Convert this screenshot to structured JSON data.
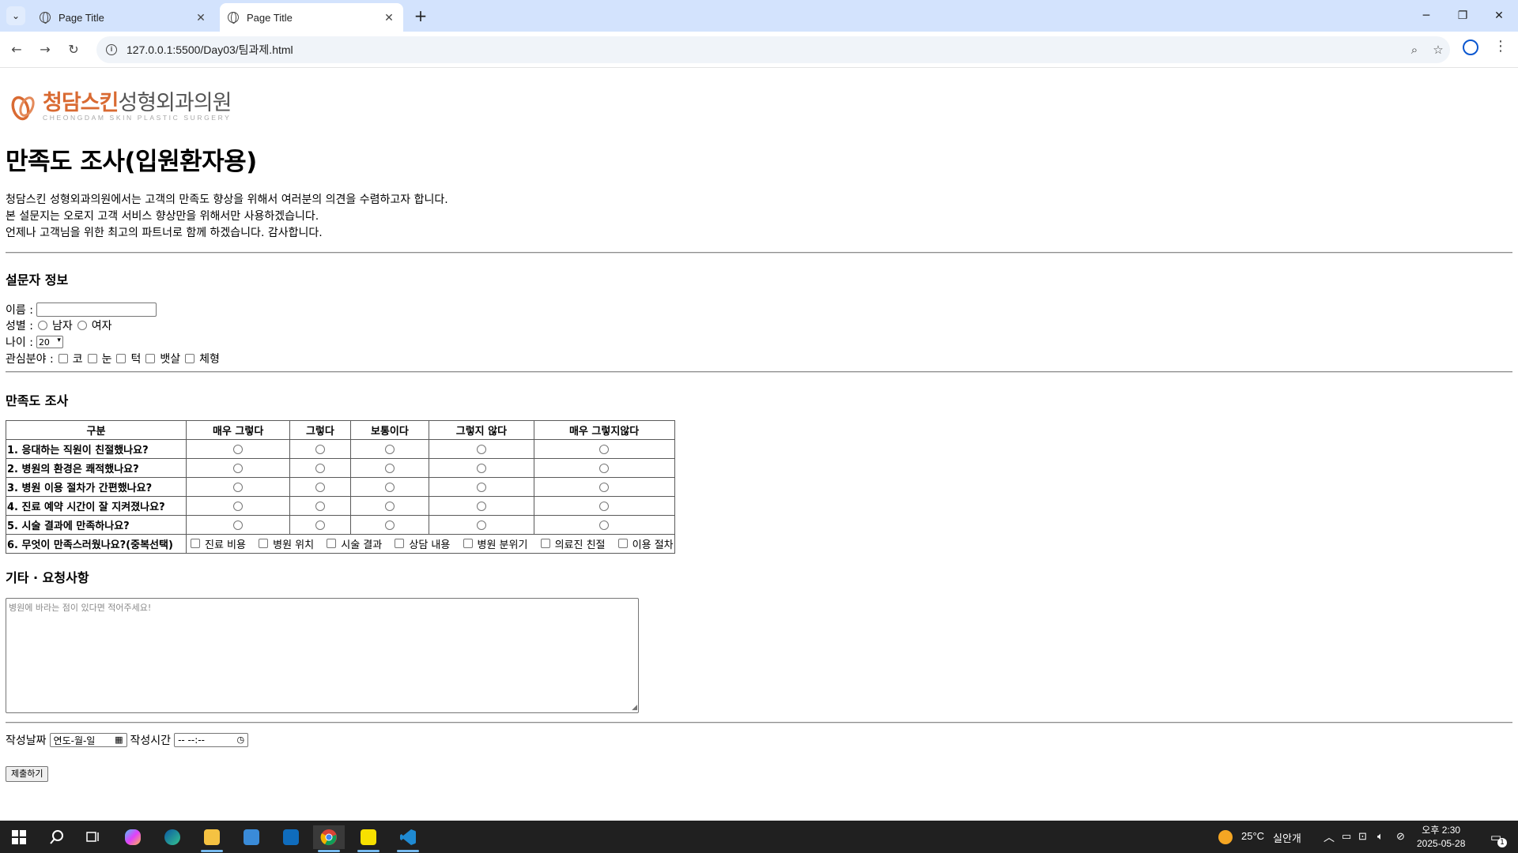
{
  "browser": {
    "tabs": [
      {
        "title": "Page Title",
        "active": false
      },
      {
        "title": "Page Title",
        "active": true
      }
    ],
    "new_tab_symbol": "+",
    "url": "127.0.0.1:5500/Day03/팀과제.html"
  },
  "logo": {
    "brand_primary": "청담스킨",
    "brand_secondary": "성형외과의원",
    "subtitle": "CHEONGDAM SKIN PLASTIC SURGERY",
    "accent_color": "#d96a32"
  },
  "page": {
    "title": "만족도 조사(입원환자용)",
    "intro": [
      "청담스킨 성형외과의원에서는 고객의 만족도 향상을 위해서 여러분의 의견을 수렴하고자 합니다.",
      "본 설문지는 오로지 고객 서비스 향상만을 위해서만 사용하겠습니다.",
      "언제나 고객님을 위한 최고의 파트너로 함께 하겠습니다. 감사합니다."
    ]
  },
  "respondent": {
    "heading": "설문자 정보",
    "name_label": "이름 :",
    "name_value": "",
    "gender_label": "성별 :",
    "gender_options": [
      "남자",
      "여자"
    ],
    "age_label": "나이 :",
    "age_selected": "20",
    "interest_label": "관심분야 :",
    "interest_options": [
      "코",
      "눈",
      "턱",
      "뱃살",
      "체형"
    ]
  },
  "survey": {
    "heading": "만족도 조사",
    "columns": [
      "구분",
      "매우 그렇다",
      "그렇다",
      "보통이다",
      "그렇지 않다",
      "매우 그렇지않다"
    ],
    "questions": [
      "1. 응대하는 직원이 친절했나요?",
      "2. 병원의 환경은 쾌적했나요?",
      "3. 병원 이용 절차가 간편했나요?",
      "4. 진료 예약 시간이 잘 지켜졌나요?",
      "5. 시술 결과에 만족하나요?"
    ],
    "multi_question": "6. 무엇이 만족스러웠나요?(중복선택)",
    "multi_options": [
      "진료 비용",
      "병원 위치",
      "시술 결과",
      "상담 내용",
      "병원 분위기",
      "의료진 친절",
      "이용 절차"
    ]
  },
  "requests": {
    "heading": "기타 · 요청사항",
    "placeholder": "병원에 바라는 점이 있다면 적어주세요!"
  },
  "footer_form": {
    "date_label": "작성날짜",
    "date_placeholder": "연도-월-일",
    "time_label": "작성시간",
    "time_placeholder": "-- --:--",
    "submit_label": "제출하기"
  },
  "taskbar": {
    "weather_temp": "25°C",
    "weather_text": "실안개",
    "clock_time": "오후 2:30",
    "clock_date": "2025-05-28",
    "notification_count": "1"
  }
}
